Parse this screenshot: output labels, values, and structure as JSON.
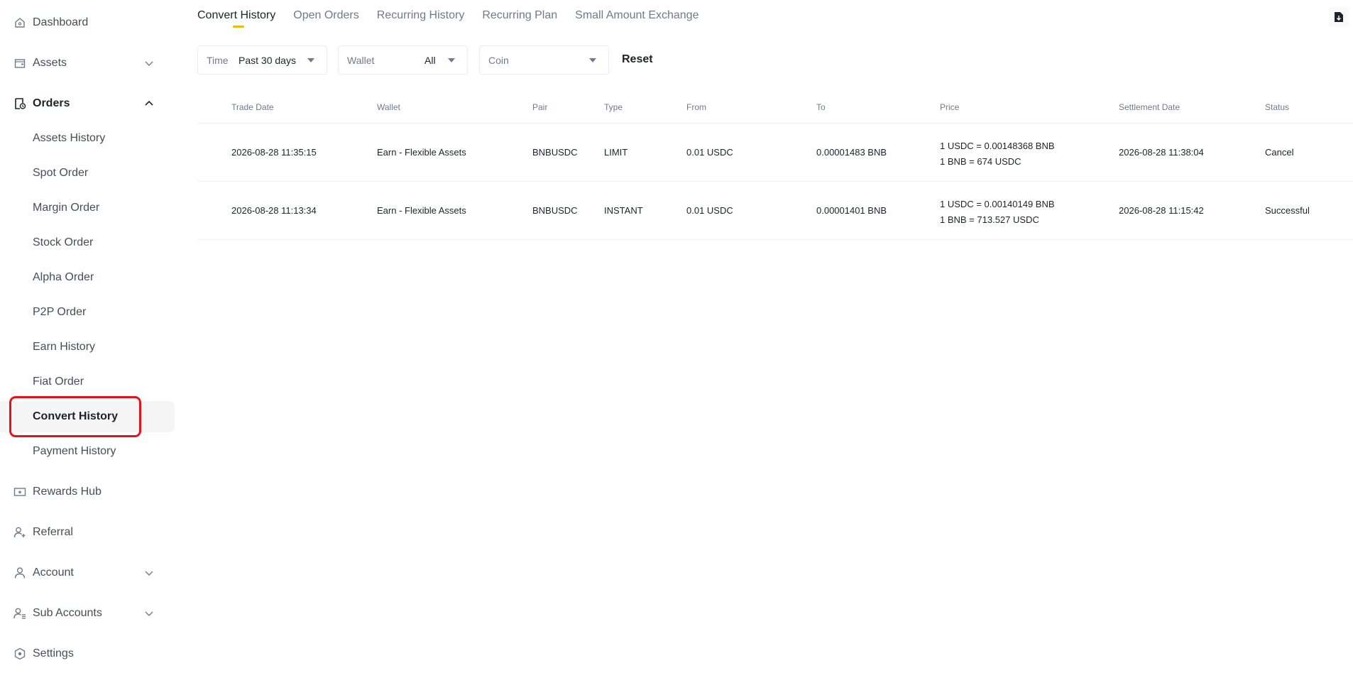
{
  "sidebar": {
    "dashboard": "Dashboard",
    "assets": "Assets",
    "orders": "Orders",
    "order_items": [
      "Assets History",
      "Spot Order",
      "Margin Order",
      "Stock Order",
      "Alpha Order",
      "P2P Order",
      "Earn History",
      "Fiat Order",
      "Convert History",
      "Payment History"
    ],
    "rewards_hub": "Rewards Hub",
    "referral": "Referral",
    "account": "Account",
    "sub_accounts": "Sub Accounts",
    "settings": "Settings"
  },
  "tabs": [
    "Convert History",
    "Open Orders",
    "Recurring History",
    "Recurring Plan",
    "Small Amount Exchange"
  ],
  "filters": {
    "time_label": "Time",
    "time_value": "Past 30 days",
    "wallet_label": "Wallet",
    "wallet_value": "All",
    "coin_placeholder": "Coin",
    "reset": "Reset"
  },
  "table": {
    "headers": [
      "Trade Date",
      "Wallet",
      "Pair",
      "Type",
      "From",
      "To",
      "Price",
      "Settlement Date",
      "Status"
    ],
    "rows": [
      {
        "trade_date": "2026-08-28 11:35:15",
        "wallet": "Earn - Flexible Assets",
        "pair": "BNBUSDC",
        "type": "LIMIT",
        "from": "0.01 USDC",
        "to": "0.00001483 BNB",
        "price_1": "1 USDC = 0.00148368 BNB",
        "price_2": "1 BNB = 674 USDC",
        "settlement_date": "2026-08-28 11:38:04",
        "status": "Cancel"
      },
      {
        "trade_date": "2026-08-28 11:13:34",
        "wallet": "Earn - Flexible Assets",
        "pair": "BNBUSDC",
        "type": "INSTANT",
        "from": "0.01 USDC",
        "to": "0.00001401 BNB",
        "price_1": "1 USDC = 0.00140149 BNB",
        "price_2": "1 BNB = 713.527 USDC",
        "settlement_date": "2026-08-28 11:15:42",
        "status": "Successful"
      }
    ]
  },
  "colors": {
    "accent": "#f0b90b",
    "highlight": "#e3131d",
    "text_primary": "#1e2329",
    "text_secondary": "#707a8a"
  },
  "icons": [
    "dashboard-icon",
    "wallet-icon",
    "orders-icon",
    "chevron-down-icon",
    "chevron-up-icon",
    "rewards-icon",
    "referral-icon",
    "account-icon",
    "sub-accounts-icon",
    "settings-icon",
    "export-icon",
    "caret-down-icon"
  ]
}
